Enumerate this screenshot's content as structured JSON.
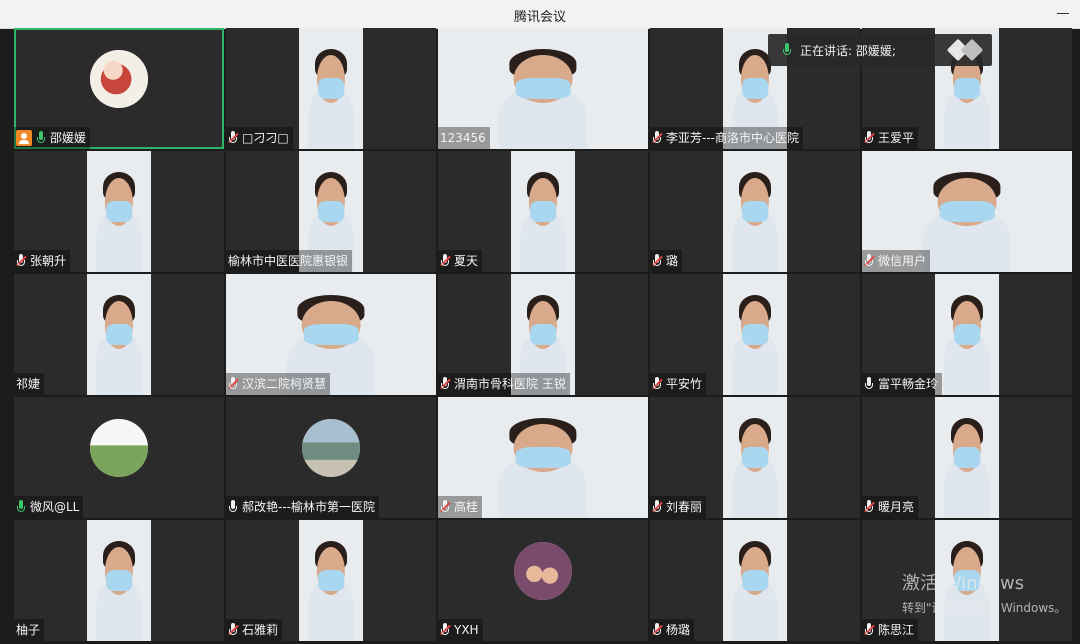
{
  "window": {
    "title": "腾讯会议"
  },
  "speaking": {
    "text": "正在讲话: 邵媛媛;"
  },
  "watermark": {
    "line1": "激活 Windows",
    "line2": "转到\"设置\"以激活 Windows。"
  },
  "participants": [
    {
      "name": "邵媛媛",
      "mic": "on",
      "host": true,
      "view": "avatar",
      "avatar": "a1",
      "active": true
    },
    {
      "name": "□刁刁□",
      "mic": "muted",
      "view": "video"
    },
    {
      "name": "123456",
      "mic": "none",
      "view": "video-wide"
    },
    {
      "name": "李亚芳---商洛市中心医院",
      "mic": "muted",
      "view": "video"
    },
    {
      "name": "王爱平",
      "mic": "muted",
      "view": "video"
    },
    {
      "name": "张朝升",
      "mic": "muted",
      "view": "video"
    },
    {
      "name": "榆林市中医医院惠银银",
      "mic": "none",
      "view": "video"
    },
    {
      "name": "夏天",
      "mic": "muted",
      "view": "video"
    },
    {
      "name": "璐",
      "mic": "muted",
      "view": "video"
    },
    {
      "name": "微信用户",
      "mic": "muted",
      "view": "video-wide"
    },
    {
      "name": "祁婕",
      "mic": "none",
      "view": "video"
    },
    {
      "name": "汉滨二院柯贤慧",
      "mic": "muted",
      "view": "video-wide"
    },
    {
      "name": "渭南市骨科医院 王锐",
      "mic": "muted",
      "view": "video"
    },
    {
      "name": "平安竹",
      "mic": "muted",
      "view": "video"
    },
    {
      "name": "富平畅金玲",
      "mic": "plain",
      "view": "video"
    },
    {
      "name": "微风@LL",
      "mic": "on",
      "view": "avatar",
      "avatar": "a2"
    },
    {
      "name": "郝改艳---榆林市第一医院",
      "mic": "plain",
      "view": "avatar",
      "avatar": "a3"
    },
    {
      "name": "高桂",
      "mic": "muted",
      "view": "video-wide"
    },
    {
      "name": "刘春丽",
      "mic": "muted",
      "view": "video"
    },
    {
      "name": "暖月亮",
      "mic": "muted",
      "view": "video"
    },
    {
      "name": "柚子",
      "mic": "none",
      "view": "video"
    },
    {
      "name": "石雅莉",
      "mic": "muted",
      "view": "video"
    },
    {
      "name": "YXH",
      "mic": "muted",
      "view": "avatar",
      "avatar": "a4"
    },
    {
      "name": "杨璐",
      "mic": "muted",
      "view": "video"
    },
    {
      "name": "陈思江",
      "mic": "muted",
      "view": "video"
    }
  ]
}
